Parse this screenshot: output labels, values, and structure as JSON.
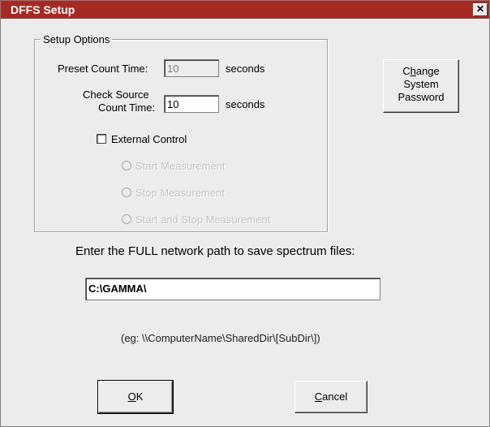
{
  "window": {
    "title": "DFFS Setup",
    "close_glyph": "✕"
  },
  "setup_options": {
    "legend": "Setup Options",
    "preset_count_time": {
      "label": "Preset Count Time:",
      "value": "10",
      "unit": "seconds",
      "enabled": false
    },
    "check_source_count_time": {
      "label_line1": "Check Source",
      "label_line2": "Count Time:",
      "value": "10",
      "unit": "seconds"
    },
    "external_control": {
      "label": "External Control",
      "checked": false
    },
    "radios": [
      {
        "label": "Start Measurement",
        "enabled": false
      },
      {
        "label": "Stop Measurement",
        "enabled": false
      },
      {
        "label": "Start and Stop Measurement",
        "enabled": false
      }
    ]
  },
  "change_password_button": {
    "line1_prefix": "C",
    "line1_accel": "h",
    "line1_suffix": "ange",
    "line2": "System",
    "line3": "Password"
  },
  "network_path": {
    "heading": "Enter the FULL network path to save spectrum files:",
    "value": "C:\\GAMMA\\",
    "example": "(eg: \\\\ComputerName\\SharedDir\\[SubDir\\])"
  },
  "ok_button": {
    "accel": "O",
    "rest": "K"
  },
  "cancel_button": {
    "accel": "C",
    "rest": "ancel"
  }
}
